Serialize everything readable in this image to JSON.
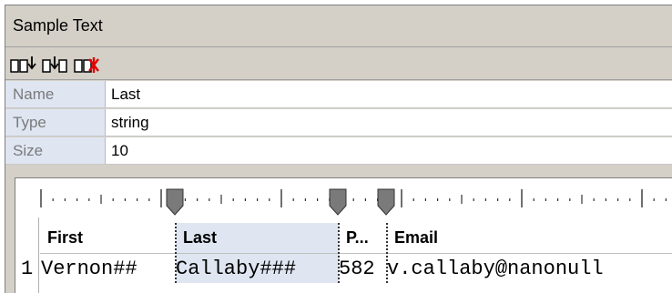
{
  "panel": {
    "title": "Sample Text"
  },
  "toolbar": {
    "buttons": [
      {
        "name": "insert-field-icon"
      },
      {
        "name": "append-field-icon"
      },
      {
        "name": "delete-field-icon"
      }
    ]
  },
  "properties": [
    {
      "key": "Name",
      "value": "Last"
    },
    {
      "key": "Type",
      "value": "string"
    },
    {
      "key": "Size",
      "value": "10"
    }
  ],
  "grid": {
    "headers": [
      "First",
      "Last",
      "P...",
      "Email"
    ],
    "selected_column": 1,
    "rows": [
      {
        "num": "1",
        "cells": [
          "Vernon##",
          "Callaby###",
          "582",
          "v.callaby@nanonull"
        ]
      }
    ]
  },
  "colors": {
    "selection": "#dfe6f2",
    "panel": "#d4d0c8",
    "delete_accent": "#e00000"
  }
}
